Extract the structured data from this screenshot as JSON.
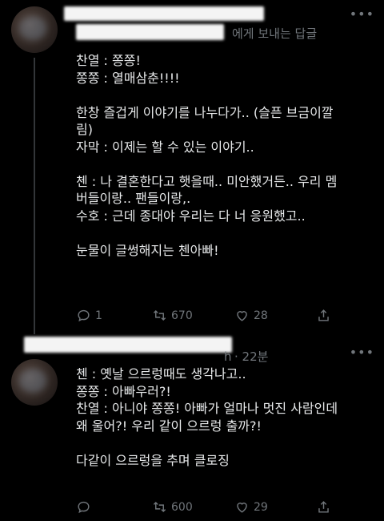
{
  "tweets": [
    {
      "header_suffix": "에게 보내는 답글",
      "time": "",
      "lines": [
        "찬열 : 쫑쫑!",
        "쫑쫑 : 열매삼춘!!!!",
        "",
        "한창 즐겁게 이야기를 나누다가.. (슬픈 브금이깔",
        "림)",
        "자막 : 이제는 할 수 있는 이야기..",
        "",
        "첸 : 나 결혼한다고 햇을때.. 미안했거든.. 우리 멤",
        "버들이랑.. 팬들이랑,.",
        "수호 : 근데 종대야 우리는 다 너 응원했고..",
        "",
        "눈물이 글썽해지는 첸아빠!"
      ],
      "actions": {
        "reply": "1",
        "retweet": "670",
        "like": "28",
        "share": ""
      }
    },
    {
      "header_suffix": "h",
      "time": "· 22분",
      "lines": [
        "첸 : 옛날 으르렁때도 생각나고..",
        "쫑쫑 : 아빠우러?!",
        "찬열 : 아니야 쫑쫑! 아빠가 얼마나 멋진 사람인데",
        "왜 울어?! 우리 같이 으르렁 출까?!",
        "",
        "다같이 으르렁을 추며 클로징"
      ],
      "actions": {
        "reply": "",
        "retweet": "600",
        "like": "29",
        "share": ""
      }
    }
  ],
  "icons": {
    "reply": "reply-icon",
    "retweet": "retweet-icon",
    "like": "heart-icon",
    "share": "share-icon",
    "more": "more-icon"
  },
  "colors": {
    "background": "#000000",
    "text": "#e7e9ea",
    "muted": "#71767b"
  }
}
